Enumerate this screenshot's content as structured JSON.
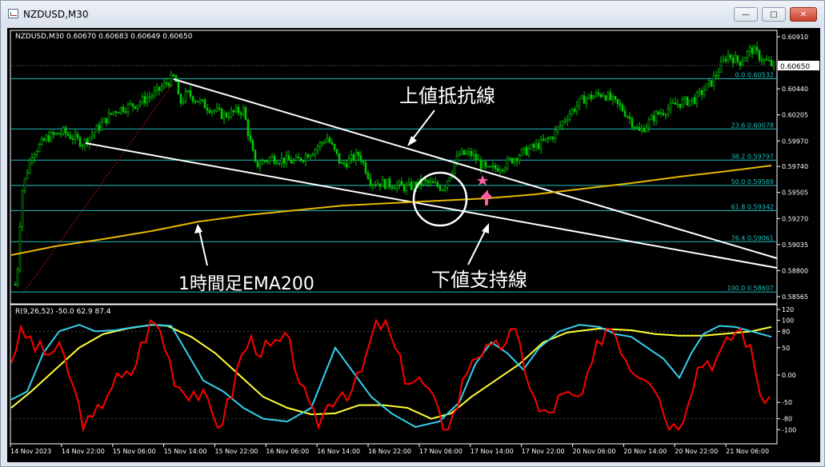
{
  "window": {
    "title": "NZDUSD,M30",
    "icons": [
      "chart-window-icon",
      "minimize-icon",
      "maximize-icon",
      "close-icon"
    ]
  },
  "main_panel": {
    "header": "NZDUSD,M30  0.60670 0.60683 0.60649 0.60650",
    "price_ticks": [
      "0.60910",
      "0.60440",
      "0.60205",
      "0.59970",
      "0.59740",
      "0.59505",
      "0.59270",
      "0.59035",
      "0.58800",
      "0.58565"
    ],
    "current_price": "0.60650",
    "fib_levels": [
      {
        "label": "0.0  0.60532",
        "value": 0.60532
      },
      {
        "label": "23.6  0.60078",
        "value": 0.60078
      },
      {
        "label": "38.2  0.59797",
        "value": 0.59797
      },
      {
        "label": "50.0  0.59569",
        "value": 0.59569
      },
      {
        "label": "61.8  0.59342",
        "value": 0.59342
      },
      {
        "label": "76.4  0.59061",
        "value": 0.59061
      },
      {
        "label": "100.0  0.58607",
        "value": 0.58607
      }
    ],
    "annotations": {
      "resistance": "上値抵抗線",
      "support": "下値支持線",
      "ema": "1時間足EMA200"
    }
  },
  "sub_panel": {
    "header": "R(9,26,52) -50.0 62.9 87.4",
    "ticks": [
      "120",
      "100",
      "80",
      "50",
      "0.00",
      "-50",
      "-80",
      "-100"
    ]
  },
  "time_axis": [
    "14 Nov 2023",
    "14 Nov 22:00",
    "15 Nov 06:00",
    "15 Nov 14:00",
    "15 Nov 22:00",
    "16 Nov 06:00",
    "16 Nov 14:00",
    "16 Nov 22:00",
    "17 Nov 06:00",
    "17 Nov 14:00",
    "17 Nov 22:00",
    "20 Nov 06:00",
    "20 Nov 14:00",
    "20 Nov 22:00",
    "21 Nov 06:00"
  ],
  "colors": {
    "background": "#000000",
    "candles": "#00c800",
    "fib": "#1fbfbf",
    "ema": "#e6b800",
    "trendlines": "#ffffff",
    "osc_red": "#ff0000",
    "osc_cyan": "#35d0ee",
    "osc_yellow": "#ffff33",
    "marker": "#ff5fa0"
  },
  "chart_data": {
    "type": "line",
    "title": "NZDUSD,M30",
    "series": [
      {
        "name": "NZDUSD,M30",
        "x": [
          "14 Nov 2023",
          "14 Nov 22:00",
          "15 Nov 06:00",
          "15 Nov 14:00",
          "15 Nov 22:00",
          "16 Nov 06:00",
          "16 Nov 14:00",
          "16 Nov 22:00",
          "17 Nov 06:00",
          "17 Nov 14:00",
          "17 Nov 22:00",
          "20 Nov 06:00",
          "20 Nov 14:00",
          "20 Nov 22:00",
          "21 Nov 06:00"
        ],
        "values": [
          0.5865,
          0.5999,
          0.6035,
          0.603,
          0.5975,
          0.598,
          0.5974,
          0.5962,
          0.5957,
          0.5974,
          0.5997,
          0.6038,
          0.6012,
          0.6037,
          0.6065
        ]
      }
    ],
    "fibonacci": [
      0.60532,
      0.60078,
      0.59797,
      0.59569,
      0.59342,
      0.59061,
      0.58607
    ],
    "ylim": [
      0.58565,
      0.6091
    ]
  }
}
